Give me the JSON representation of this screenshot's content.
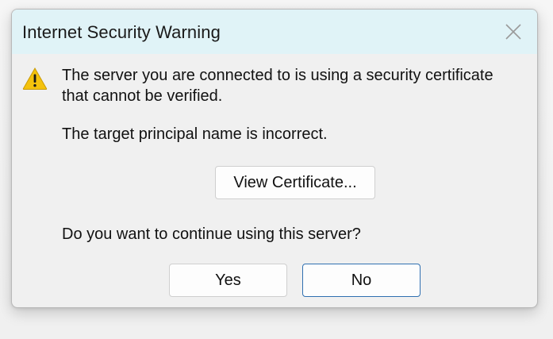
{
  "dialog": {
    "title": "Internet Security Warning",
    "close_icon": "close-icon",
    "warning_icon": "warning-triangle-icon",
    "message_line1": "The server you are connected to is using a security certificate",
    "message_line2": "that cannot be verified.",
    "detail": "The target principal name is incorrect.",
    "view_certificate_label": "View Certificate...",
    "question": "Do you want to continue using this server?",
    "yes_label": "Yes",
    "no_label": "No"
  },
  "colors": {
    "titlebar_bg": "#e0f3f7",
    "dialog_bg": "#f0f0f0",
    "warning_yellow": "#f4c20d",
    "default_button_border": "#2f6fb0"
  }
}
